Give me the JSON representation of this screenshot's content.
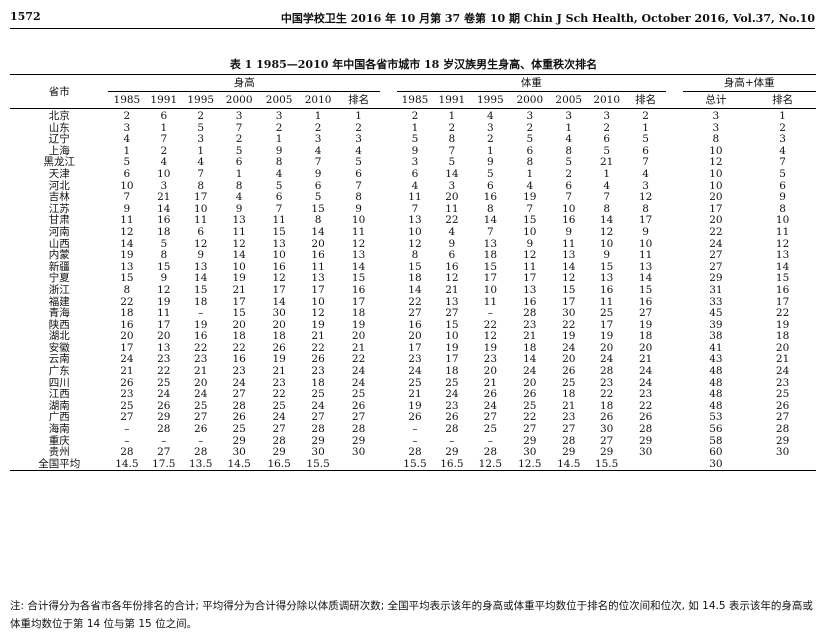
{
  "page_header": {
    "page_number": "1572",
    "journal": "中国学校卫生 2016 年 10 月第 37 卷第 10 期  Chin J Sch Health, October  2016, Vol.37, No.10"
  },
  "table_title": "表 1   1985—2010 年中国各省市城市 18 岁汉族男生身高、体重秩次排名",
  "headers": {
    "province": "省市",
    "height_group": "身高",
    "weight_group": "体重",
    "combined_group": "身高+体重",
    "years": [
      "1985",
      "1991",
      "1995",
      "2000",
      "2005",
      "2010"
    ],
    "rank": "排名",
    "total": "总计"
  },
  "rows": [
    {
      "province": "北京",
      "height": [
        "2",
        "6",
        "2",
        "3",
        "3",
        "1",
        "1"
      ],
      "weight": [
        "2",
        "1",
        "4",
        "3",
        "3",
        "3",
        "2"
      ],
      "combined": [
        "3",
        "1"
      ]
    },
    {
      "province": "山东",
      "height": [
        "3",
        "1",
        "5",
        "7",
        "2",
        "2",
        "2"
      ],
      "weight": [
        "1",
        "2",
        "3",
        "2",
        "1",
        "2",
        "1"
      ],
      "combined": [
        "3",
        "2"
      ]
    },
    {
      "province": "辽宁",
      "height": [
        "4",
        "7",
        "3",
        "2",
        "1",
        "3",
        "3"
      ],
      "weight": [
        "5",
        "8",
        "2",
        "5",
        "4",
        "6",
        "5"
      ],
      "combined": [
        "8",
        "3"
      ]
    },
    {
      "province": "上海",
      "height": [
        "1",
        "2",
        "1",
        "5",
        "9",
        "4",
        "4"
      ],
      "weight": [
        "9",
        "7",
        "1",
        "6",
        "8",
        "5",
        "6"
      ],
      "combined": [
        "10",
        "4"
      ]
    },
    {
      "province": "黑龙江",
      "height": [
        "5",
        "4",
        "4",
        "6",
        "8",
        "7",
        "5"
      ],
      "weight": [
        "3",
        "5",
        "9",
        "8",
        "5",
        "21",
        "7"
      ],
      "combined": [
        "12",
        "7"
      ]
    },
    {
      "province": "天津",
      "height": [
        "6",
        "10",
        "7",
        "1",
        "4",
        "9",
        "6"
      ],
      "weight": [
        "6",
        "14",
        "5",
        "1",
        "2",
        "1",
        "4"
      ],
      "combined": [
        "10",
        "5"
      ]
    },
    {
      "province": "河北",
      "height": [
        "10",
        "3",
        "8",
        "8",
        "5",
        "6",
        "7"
      ],
      "weight": [
        "4",
        "3",
        "6",
        "4",
        "6",
        "4",
        "3"
      ],
      "combined": [
        "10",
        "6"
      ]
    },
    {
      "province": "吉林",
      "height": [
        "7",
        "21",
        "17",
        "4",
        "6",
        "5",
        "8"
      ],
      "weight": [
        "11",
        "20",
        "16",
        "19",
        "7",
        "7",
        "12"
      ],
      "combined": [
        "20",
        "9"
      ]
    },
    {
      "province": "江苏",
      "height": [
        "9",
        "14",
        "10",
        "9",
        "7",
        "15",
        "9"
      ],
      "weight": [
        "7",
        "11",
        "8",
        "7",
        "10",
        "8",
        "8"
      ],
      "combined": [
        "17",
        "8"
      ]
    },
    {
      "province": "甘肃",
      "height": [
        "11",
        "16",
        "11",
        "13",
        "11",
        "8",
        "10"
      ],
      "weight": [
        "13",
        "22",
        "14",
        "15",
        "16",
        "14",
        "17"
      ],
      "combined": [
        "20",
        "10"
      ]
    },
    {
      "province": "河南",
      "height": [
        "12",
        "18",
        "6",
        "11",
        "15",
        "14",
        "11"
      ],
      "weight": [
        "10",
        "4",
        "7",
        "10",
        "9",
        "12",
        "9"
      ],
      "combined": [
        "22",
        "11"
      ]
    },
    {
      "province": "山西",
      "height": [
        "14",
        "5",
        "12",
        "12",
        "13",
        "20",
        "12"
      ],
      "weight": [
        "12",
        "9",
        "13",
        "9",
        "11",
        "10",
        "10"
      ],
      "combined": [
        "24",
        "12"
      ]
    },
    {
      "province": "内蒙",
      "height": [
        "19",
        "8",
        "9",
        "14",
        "10",
        "16",
        "13"
      ],
      "weight": [
        "8",
        "6",
        "18",
        "12",
        "13",
        "9",
        "11"
      ],
      "combined": [
        "27",
        "13"
      ]
    },
    {
      "province": "新疆",
      "height": [
        "13",
        "15",
        "13",
        "10",
        "16",
        "11",
        "14"
      ],
      "weight": [
        "15",
        "16",
        "15",
        "11",
        "14",
        "15",
        "13"
      ],
      "combined": [
        "27",
        "14"
      ]
    },
    {
      "province": "宁夏",
      "height": [
        "15",
        "9",
        "14",
        "19",
        "12",
        "13",
        "15"
      ],
      "weight": [
        "18",
        "12",
        "17",
        "17",
        "12",
        "13",
        "14"
      ],
      "combined": [
        "29",
        "15"
      ]
    },
    {
      "province": "浙江",
      "height": [
        "8",
        "12",
        "15",
        "21",
        "17",
        "17",
        "16"
      ],
      "weight": [
        "14",
        "21",
        "10",
        "13",
        "15",
        "16",
        "15"
      ],
      "combined": [
        "31",
        "16"
      ]
    },
    {
      "province": "福建",
      "height": [
        "22",
        "19",
        "18",
        "17",
        "14",
        "10",
        "17"
      ],
      "weight": [
        "22",
        "13",
        "11",
        "16",
        "17",
        "11",
        "16"
      ],
      "combined": [
        "33",
        "17"
      ]
    },
    {
      "province": "青海",
      "height": [
        "18",
        "11",
        "–",
        "15",
        "30",
        "12",
        "18"
      ],
      "weight": [
        "27",
        "27",
        "–",
        "28",
        "30",
        "25",
        "27"
      ],
      "combined": [
        "45",
        "22"
      ]
    },
    {
      "province": "陕西",
      "height": [
        "16",
        "17",
        "19",
        "20",
        "20",
        "19",
        "19"
      ],
      "weight": [
        "16",
        "15",
        "22",
        "23",
        "22",
        "17",
        "19"
      ],
      "combined": [
        "39",
        "19"
      ]
    },
    {
      "province": "湖北",
      "height": [
        "20",
        "20",
        "16",
        "18",
        "18",
        "21",
        "20"
      ],
      "weight": [
        "20",
        "10",
        "12",
        "21",
        "19",
        "19",
        "18"
      ],
      "combined": [
        "38",
        "18"
      ]
    },
    {
      "province": "安徽",
      "height": [
        "17",
        "13",
        "22",
        "22",
        "26",
        "22",
        "21"
      ],
      "weight": [
        "17",
        "19",
        "19",
        "18",
        "24",
        "20",
        "20"
      ],
      "combined": [
        "41",
        "20"
      ]
    },
    {
      "province": "云南",
      "height": [
        "24",
        "23",
        "23",
        "16",
        "19",
        "26",
        "22"
      ],
      "weight": [
        "23",
        "17",
        "23",
        "14",
        "20",
        "24",
        "21"
      ],
      "combined": [
        "43",
        "21"
      ]
    },
    {
      "province": "广东",
      "height": [
        "21",
        "22",
        "21",
        "23",
        "21",
        "23",
        "24"
      ],
      "weight": [
        "24",
        "18",
        "20",
        "24",
        "26",
        "28",
        "24"
      ],
      "combined": [
        "48",
        "24"
      ]
    },
    {
      "province": "四川",
      "height": [
        "26",
        "25",
        "20",
        "24",
        "23",
        "18",
        "24"
      ],
      "weight": [
        "25",
        "25",
        "21",
        "20",
        "25",
        "23",
        "24"
      ],
      "combined": [
        "48",
        "23"
      ]
    },
    {
      "province": "江西",
      "height": [
        "23",
        "24",
        "24",
        "27",
        "22",
        "25",
        "25"
      ],
      "weight": [
        "21",
        "24",
        "26",
        "26",
        "18",
        "22",
        "23"
      ],
      "combined": [
        "48",
        "25"
      ]
    },
    {
      "province": "湖南",
      "height": [
        "25",
        "26",
        "25",
        "28",
        "25",
        "24",
        "26"
      ],
      "weight": [
        "19",
        "23",
        "24",
        "25",
        "21",
        "18",
        "22"
      ],
      "combined": [
        "48",
        "26"
      ]
    },
    {
      "province": "广西",
      "height": [
        "27",
        "29",
        "27",
        "26",
        "24",
        "27",
        "27"
      ],
      "weight": [
        "26",
        "26",
        "27",
        "22",
        "23",
        "26",
        "26"
      ],
      "combined": [
        "53",
        "27"
      ]
    },
    {
      "province": "海南",
      "height": [
        "–",
        "28",
        "26",
        "25",
        "27",
        "28",
        "28"
      ],
      "weight": [
        "–",
        "28",
        "25",
        "27",
        "27",
        "30",
        "28"
      ],
      "combined": [
        "56",
        "28"
      ]
    },
    {
      "province": "重庆",
      "height": [
        "–",
        "–",
        "–",
        "29",
        "28",
        "29",
        "29"
      ],
      "weight": [
        "–",
        "–",
        "–",
        "29",
        "28",
        "27",
        "29"
      ],
      "combined": [
        "58",
        "29"
      ]
    },
    {
      "province": "贵州",
      "height": [
        "28",
        "27",
        "28",
        "30",
        "29",
        "30",
        "30"
      ],
      "weight": [
        "28",
        "29",
        "28",
        "30",
        "29",
        "29",
        "30"
      ],
      "combined": [
        "60",
        "30"
      ]
    },
    {
      "province": "全国平均",
      "height": [
        "14.5",
        "17.5",
        "13.5",
        "14.5",
        "16.5",
        "15.5",
        ""
      ],
      "weight": [
        "15.5",
        "16.5",
        "12.5",
        "12.5",
        "14.5",
        "15.5",
        ""
      ],
      "combined": [
        "30",
        ""
      ]
    }
  ],
  "note": "注: 合计得分为各省市各年份排名的合计; 平均得分为合计得分除以体质调研次数; 全国平均表示该年的身高或体重平均数位于排名的位次间和位次, 如 14.5 表示该年的身高或体重均数位于第 14 位与第 15 位之间。"
}
